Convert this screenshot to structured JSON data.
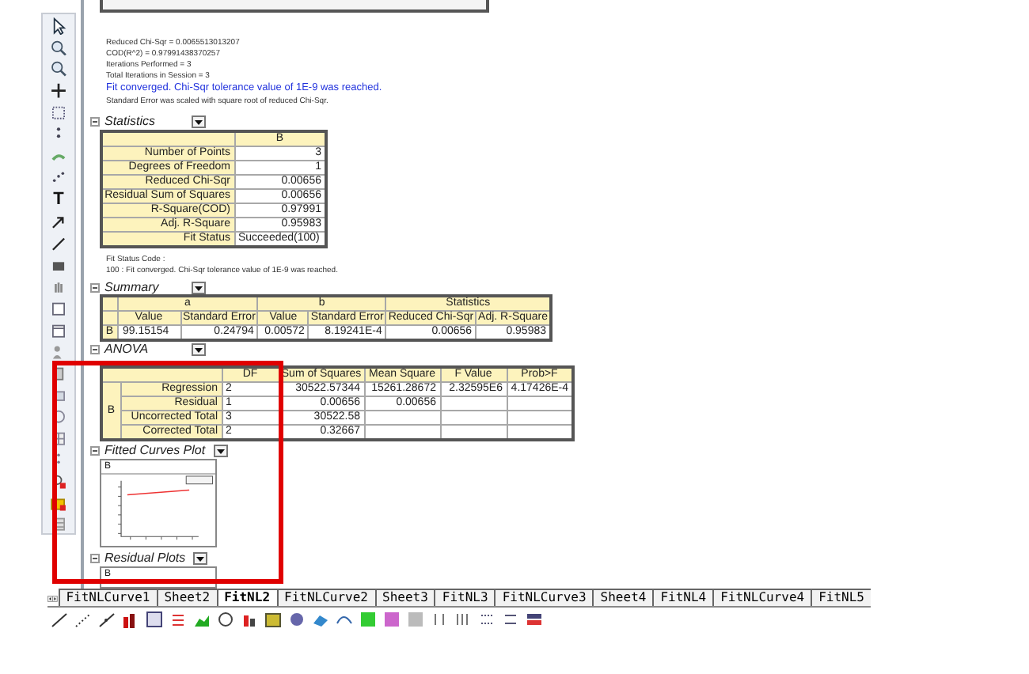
{
  "messages": [
    {
      "kind": "note",
      "text": "Reduced Chi-Sqr = 0.0065513013207"
    },
    {
      "kind": "note",
      "text": "COD(R^2) = 0.97991438370257"
    },
    {
      "kind": "note",
      "text": "Iterations Performed = 3"
    },
    {
      "kind": "note",
      "text": "Total Iterations in Session = 3"
    },
    {
      "kind": "highlight",
      "text": "Fit converged. Chi-Sqr tolerance value of 1E-9 was reached."
    },
    {
      "kind": "note",
      "text": "Standard Error was scaled with square root of reduced Chi-Sqr."
    }
  ],
  "statistics": {
    "title": "Statistics",
    "column": "B",
    "rows": [
      {
        "label": "Number of Points",
        "value": "3"
      },
      {
        "label": "Degrees of Freedom",
        "value": "1"
      },
      {
        "label": "Reduced Chi-Sqr",
        "value": "0.00656"
      },
      {
        "label": "Residual Sum of Squares",
        "value": "0.00656"
      },
      {
        "label": "R-Square(COD)",
        "value": "0.97991"
      },
      {
        "label": "Adj. R-Square",
        "value": "0.95983"
      },
      {
        "label": "Fit Status",
        "value": "Succeeded(100)"
      }
    ]
  },
  "fit_status_code": {
    "title": "Fit Status Code :",
    "text": "100 : Fit converged. Chi-Sqr tolerance value of 1E-9 was reached."
  },
  "summary": {
    "title": "Summary",
    "groups": [
      "a",
      "b",
      "Statistics"
    ],
    "columns": [
      "Value",
      "Standard Error",
      "Value",
      "Standard Error",
      "Reduced Chi-Sqr",
      "Adj. R-Square"
    ],
    "rows": [
      {
        "label": "B",
        "cells": [
          "99.15154",
          "0.24794",
          "0.00572",
          "8.19241E-4",
          "0.00656",
          "0.95983"
        ]
      }
    ]
  },
  "anova": {
    "title": "ANOVA",
    "group_label": "B",
    "columns": [
      "DF",
      "Sum of Squares",
      "Mean Square",
      "F Value",
      "Prob>F"
    ],
    "rows": [
      {
        "label": "Regression",
        "cells": [
          "2",
          "30522.57344",
          "15261.28672",
          "2.32595E6",
          "4.17426E-4"
        ]
      },
      {
        "label": "Residual",
        "cells": [
          "1",
          "0.00656",
          "0.00656",
          "",
          ""
        ]
      },
      {
        "label": "Uncorrected Total",
        "cells": [
          "3",
          "30522.58",
          "",
          "",
          ""
        ]
      },
      {
        "label": "Corrected Total",
        "cells": [
          "2",
          "0.32667",
          "",
          "",
          ""
        ]
      }
    ]
  },
  "fitted_curves_plot": {
    "title": "Fitted Curves Plot",
    "label": "B"
  },
  "residual_plots": {
    "title": "Residual Plots",
    "label": "B"
  },
  "text_tool": "T",
  "sheet_tabs": [
    {
      "label": "FitNLCurve1",
      "selected": false
    },
    {
      "label": "Sheet2",
      "selected": false
    },
    {
      "label": "FitNL2",
      "selected": true
    },
    {
      "label": "FitNLCurve2",
      "selected": false
    },
    {
      "label": "Sheet3",
      "selected": false
    },
    {
      "label": "FitNL3",
      "selected": false
    },
    {
      "label": "FitNLCurve3",
      "selected": false
    },
    {
      "label": "Sheet4",
      "selected": false
    },
    {
      "label": "FitNL4",
      "selected": false
    },
    {
      "label": "FitNLCurve4",
      "selected": false
    },
    {
      "label": "FitNL5",
      "selected": false
    }
  ]
}
